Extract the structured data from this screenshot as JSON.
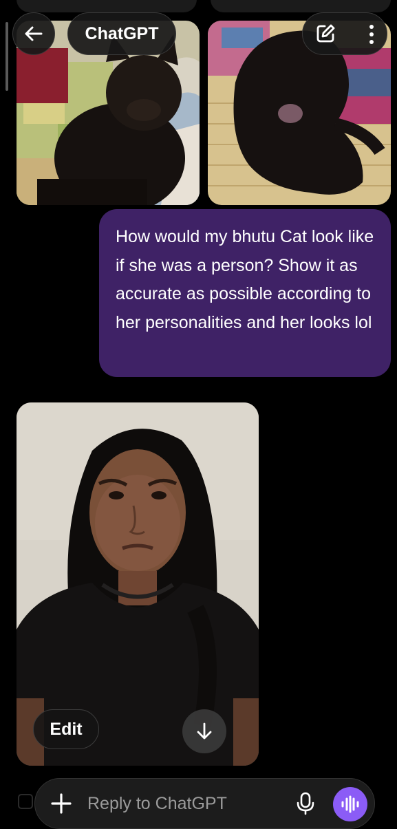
{
  "header": {
    "title": "ChatGPT",
    "back_icon": "arrow-left-icon",
    "compose_icon": "new-chat-pencil-icon",
    "menu_icon": "more-vertical-icon"
  },
  "conversation": {
    "attachments": [
      {
        "name": "black-cat-photo-1"
      },
      {
        "name": "black-cat-photo-2"
      }
    ],
    "user_message": "How would my bhutu Cat look like if she was a person? Show it as accurate as possible according to her personalities and her looks lol",
    "user_bubble_color": "#3f2266",
    "generated_image": {
      "edit_label": "Edit",
      "scroll_down_icon": "arrow-down-icon"
    }
  },
  "composer": {
    "plus_icon": "plus-icon",
    "placeholder": "Reply to ChatGPT",
    "mic_icon": "microphone-icon",
    "voice_icon": "voice-waveform-icon",
    "voice_button_color": "#8b5cf6"
  }
}
